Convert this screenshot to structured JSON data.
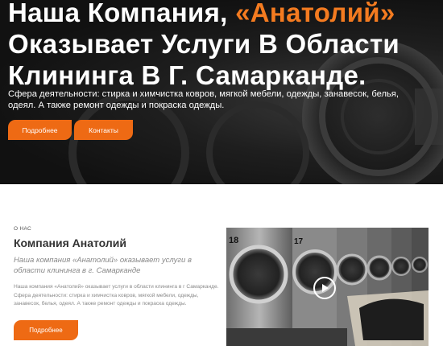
{
  "hero": {
    "title_part1": "Наша Компания, ",
    "title_accent": "«Анатолий»",
    "title_part2": "Оказывает Услуги В Области Клининга В Г. Самарканде.",
    "description": "Сфера деятельности: стирка и химчистка ковров, мягкой мебели, одежды, занавесок, белья, одеял. А также ремонт одежды и покраска одежды.",
    "buttons": {
      "more_label": "Подробнее",
      "contacts_label": "Контакты"
    }
  },
  "about": {
    "kicker": "О НАС",
    "title": "Компания Анатолий",
    "lead": "Наша компания «Анатолий» оказывает услуги в области клининга в г. Самарканде",
    "body": "Наша компания «Анатолий» оказывает услуги в области клининга в г Самарканде. Сфера деятельности: стирка и химчистка ковров, мягкой мебели, одежды, занавесок, белья, одеял. А также ремонт одежды и покраска одежды.",
    "more_label": "Подробнее",
    "photo_numbers": [
      "18",
      "17"
    ]
  },
  "colors": {
    "accent": "#ee6a14",
    "hero_background": "#111111"
  },
  "icons": {
    "video": "play-icon"
  }
}
